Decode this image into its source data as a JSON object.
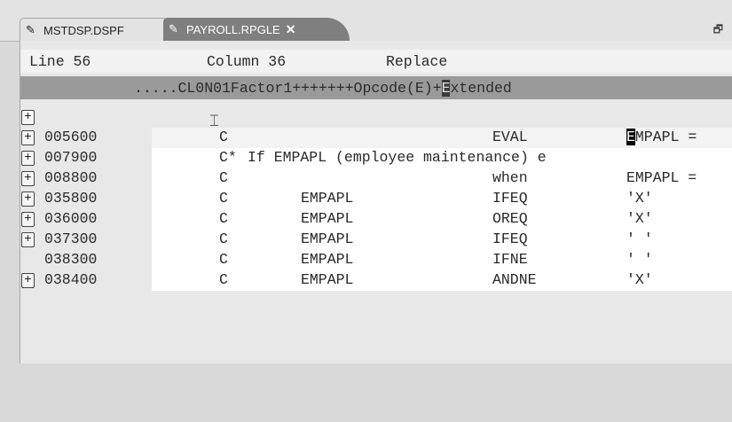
{
  "tabs": [
    {
      "label": "MSTDSP.DSPF",
      "icon": "pencil-icon",
      "active": false
    },
    {
      "label": "PAYROLL.RPGLE",
      "icon": "pencil-icon",
      "active": true,
      "close": "✕"
    }
  ],
  "window_controls": {
    "maximize": "🗗"
  },
  "status": {
    "line": "Line 56",
    "column": "Column 36",
    "mode": "Replace"
  },
  "ruler": {
    "before": ".....CL0N01Factor1+++++++Opcode(E)+",
    "cursor_char": "E",
    "after": "xtended"
  },
  "expand_glyph": "+",
  "rows": [
    {
      "expander": true,
      "seq": "",
      "spec": "",
      "factor": "",
      "opcode": "",
      "ext": "",
      "comment": ""
    },
    {
      "expander": true,
      "seq": "005600",
      "spec": "C",
      "factor": "",
      "opcode": "EVAL",
      "ext_cursor": "E",
      "ext": "MPAPL =",
      "comment": "",
      "current": true
    },
    {
      "expander": true,
      "seq": "007900",
      "spec": "C*",
      "factor": "",
      "opcode": "",
      "ext": "",
      "comment": "If EMPAPL (employee maintenance) e"
    },
    {
      "expander": true,
      "seq": "008800",
      "spec": "C",
      "factor": "",
      "opcode": "when",
      "ext": "EMPAPL =",
      "comment": ""
    },
    {
      "expander": true,
      "seq": "035800",
      "spec": "C",
      "factor": "EMPAPL",
      "opcode": "IFEQ",
      "ext": "'X'",
      "comment": ""
    },
    {
      "expander": true,
      "seq": "036000",
      "spec": "C",
      "factor": "EMPAPL",
      "opcode": "OREQ",
      "ext": "'X'",
      "comment": ""
    },
    {
      "expander": true,
      "seq": "037300",
      "spec": "C",
      "factor": "EMPAPL",
      "opcode": "IFEQ",
      "ext": "' '",
      "comment": ""
    },
    {
      "expander": false,
      "seq": "038300",
      "spec": "C",
      "factor": "EMPAPL",
      "opcode": "IFNE",
      "ext": "' '",
      "comment": ""
    },
    {
      "expander": true,
      "seq": "038400",
      "spec": "C",
      "factor": "EMPAPL",
      "opcode": "ANDNE",
      "ext": "'X'",
      "comment": ""
    }
  ]
}
